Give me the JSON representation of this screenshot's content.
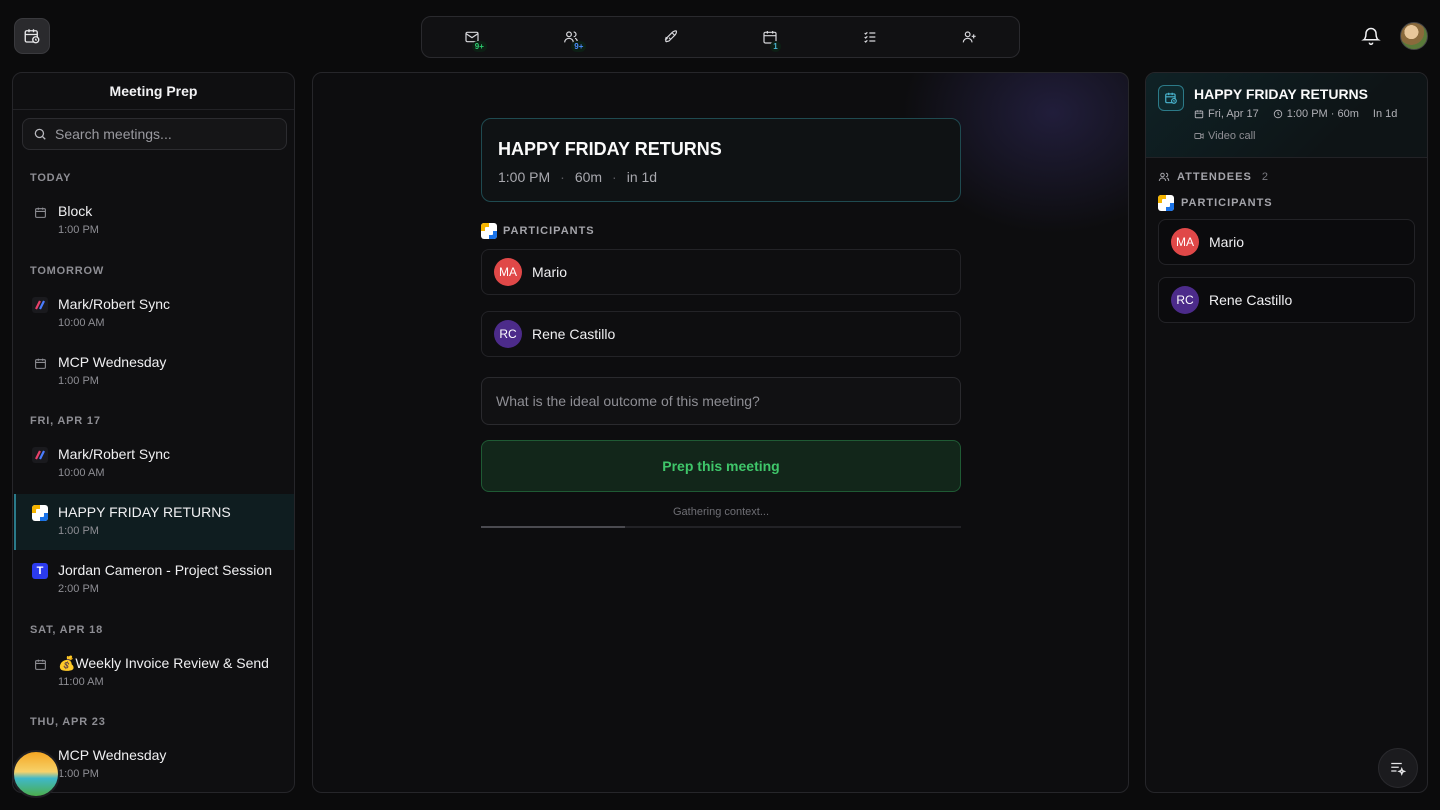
{
  "topnav": {
    "items": [
      {
        "name": "mail-icon",
        "badge": "9+",
        "badge_color": "#2ecc71"
      },
      {
        "name": "people-icon",
        "badge": "9+",
        "badge_color": "#4a8cff"
      },
      {
        "name": "rocket-icon",
        "badge": ""
      },
      {
        "name": "calendar-icon",
        "badge": "1",
        "badge_color": "#4ab6d0"
      },
      {
        "name": "checklist-icon",
        "badge": ""
      },
      {
        "name": "add-user-icon",
        "badge": ""
      }
    ]
  },
  "sidebar": {
    "title": "Meeting Prep",
    "search_placeholder": "Search meetings...",
    "groups": [
      {
        "label": "TODAY",
        "meetings": [
          {
            "title": "Block",
            "time": "1:00 PM",
            "icon": "calendar-icon"
          }
        ]
      },
      {
        "label": "TOMORROW",
        "meetings": [
          {
            "title": "Mark/Robert Sync",
            "time": "10:00 AM",
            "icon": "stripe-icon"
          },
          {
            "title": "MCP Wednesday",
            "time": "1:00 PM",
            "icon": "calendar-icon"
          }
        ]
      },
      {
        "label": "FRI, APR 17",
        "meetings": [
          {
            "title": "Mark/Robert Sync",
            "time": "10:00 AM",
            "icon": "stripe-icon"
          },
          {
            "title": "HAPPY FRIDAY RETURNS",
            "time": "1:00 PM",
            "icon": "google-calendar-icon",
            "active": true
          },
          {
            "title": "Jordan Cameron - Project Session",
            "time": "2:00 PM",
            "icon": "t-icon"
          }
        ]
      },
      {
        "label": "SAT, APR 18",
        "meetings": [
          {
            "title": "💰Weekly Invoice Review & Send",
            "time": "11:00 AM",
            "icon": "calendar-icon"
          }
        ]
      },
      {
        "label": "THU, APR 23",
        "meetings": [
          {
            "title": "MCP Wednesday",
            "time": "1:00 PM",
            "icon": "calendar-icon"
          }
        ]
      }
    ]
  },
  "main": {
    "meeting_title": "HAPPY FRIDAY RETURNS",
    "time": "1:00 PM",
    "duration": "60m",
    "relative": "in 1d",
    "participants_label": "PARTICIPANTS",
    "participants": [
      {
        "initials": "MA",
        "name": "Mario",
        "color": "#e04848"
      },
      {
        "initials": "RC",
        "name": "Rene Castillo",
        "color": "#4c2b8a"
      }
    ],
    "outcome_placeholder": "What is the ideal outcome of this meeting?",
    "prep_button": "Prep this meeting",
    "status_text": "Gathering context...",
    "progress": 0.3
  },
  "details": {
    "title": "HAPPY FRIDAY RETURNS",
    "date": "Fri, Apr 17",
    "time_duration": "1:00 PM · 60m",
    "relative": "In 1d",
    "location": "Video call",
    "attendees_label": "ATTENDEES",
    "attendees_count": "2",
    "participants_label": "PARTICIPANTS",
    "participants": [
      {
        "initials": "MA",
        "name": "Mario"
      },
      {
        "initials": "RC",
        "name": "Rene Castillo"
      }
    ]
  },
  "colors": {
    "accent_teal": "#2a7a8a",
    "prep_green": "#3fc66a",
    "background": "#0b0b0c"
  }
}
